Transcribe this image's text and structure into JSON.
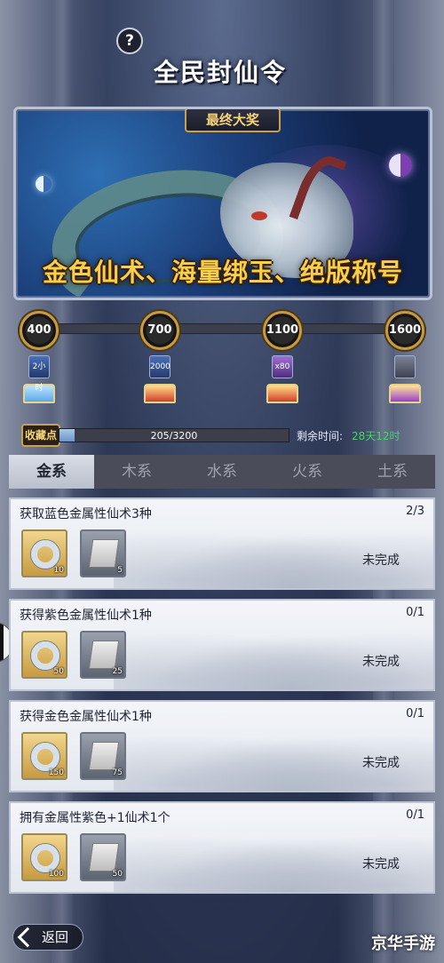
{
  "header": {
    "help_label": "?",
    "title": "全民封仙令",
    "prize_tag": "最终大奖",
    "reward_text": "金色仙术、海量绑玉、绝版称号"
  },
  "milestones": [
    {
      "points": "400",
      "item_label": "2小时",
      "chest": "blue"
    },
    {
      "points": "700",
      "item_label": "2000",
      "chest": "red"
    },
    {
      "points": "1100",
      "item_label": "x80",
      "chest": "red"
    },
    {
      "points": "1600",
      "item_label": "",
      "chest": "purple"
    }
  ],
  "progress": {
    "label": "收藏点",
    "current": 205,
    "max": 3200,
    "text": "205/3200",
    "remaining_label": "剩余时间:",
    "remaining_value": "28天12时"
  },
  "tabs": [
    {
      "label": "金系",
      "active": true
    },
    {
      "label": "木系",
      "active": false
    },
    {
      "label": "水系",
      "active": false
    },
    {
      "label": "火系",
      "active": false
    },
    {
      "label": "土系",
      "active": false
    }
  ],
  "tasks": [
    {
      "title": "获取蓝色金属性仙术3种",
      "count": "2/3",
      "status": "未完成",
      "rewards": [
        {
          "qty": "10"
        },
        {
          "qty": "5"
        }
      ]
    },
    {
      "title": "获得紫色金属性仙术1种",
      "count": "0/1",
      "status": "未完成",
      "rewards": [
        {
          "qty": "50"
        },
        {
          "qty": "25"
        }
      ]
    },
    {
      "title": "获得金色金属性仙术1种",
      "count": "0/1",
      "status": "未完成",
      "rewards": [
        {
          "qty": "150"
        },
        {
          "qty": "75"
        }
      ]
    },
    {
      "title": "拥有金属性紫色+1仙术1个",
      "count": "0/1",
      "status": "未完成",
      "rewards": [
        {
          "qty": "100"
        },
        {
          "qty": "50"
        }
      ]
    }
  ],
  "footer": {
    "back_label": "返回",
    "watermark": "京华手游"
  },
  "icons": {
    "help": "question-icon",
    "back": "back-arrow-icon",
    "reward_1": "jade-ring-icon",
    "reward_2": "scroll-icon",
    "chest": "treasure-chest-icon"
  }
}
